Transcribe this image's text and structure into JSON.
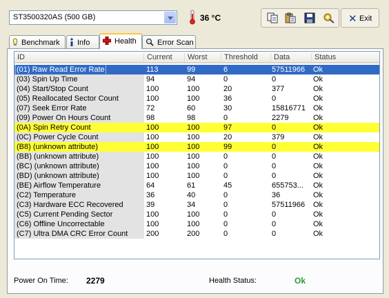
{
  "drive": {
    "selected": "ST3500320AS (500 GB)"
  },
  "temperature": {
    "value": "36 °C"
  },
  "toolbar": {
    "icons": [
      "copy-icon",
      "paste-icon",
      "save-icon",
      "options-icon"
    ]
  },
  "exit_label": "Exit",
  "tabs": [
    {
      "label": "Benchmark",
      "icon": "benchmark-icon"
    },
    {
      "label": "Info",
      "icon": "info-icon"
    },
    {
      "label": "Health",
      "icon": "health-cross-icon",
      "active": true
    },
    {
      "label": "Error Scan",
      "icon": "magnifier-icon"
    }
  ],
  "table": {
    "columns": [
      "ID",
      "Current",
      "Worst",
      "Threshold",
      "Data",
      "Status"
    ],
    "rows": [
      {
        "id": "(01) Raw Read Error Rate",
        "current": "113",
        "worst": "99",
        "threshold": "6",
        "data": "57511966",
        "status": "Ok",
        "state": "selected"
      },
      {
        "id": "(03) Spin Up Time",
        "current": "94",
        "worst": "94",
        "threshold": "0",
        "data": "0",
        "status": "Ok"
      },
      {
        "id": "(04) Start/Stop Count",
        "current": "100",
        "worst": "100",
        "threshold": "20",
        "data": "377",
        "status": "Ok"
      },
      {
        "id": "(05) Reallocated Sector Count",
        "current": "100",
        "worst": "100",
        "threshold": "36",
        "data": "0",
        "status": "Ok"
      },
      {
        "id": "(07) Seek Error Rate",
        "current": "72",
        "worst": "60",
        "threshold": "30",
        "data": "15816771",
        "status": "Ok"
      },
      {
        "id": "(09) Power On Hours Count",
        "current": "98",
        "worst": "98",
        "threshold": "0",
        "data": "2279",
        "status": "Ok"
      },
      {
        "id": "(0A) Spin Retry Count",
        "current": "100",
        "worst": "100",
        "threshold": "97",
        "data": "0",
        "status": "Ok",
        "state": "highlight"
      },
      {
        "id": "(0C) Power Cycle Count",
        "current": "100",
        "worst": "100",
        "threshold": "20",
        "data": "379",
        "status": "Ok"
      },
      {
        "id": "(B8) (unknown attribute)",
        "current": "100",
        "worst": "100",
        "threshold": "99",
        "data": "0",
        "status": "Ok",
        "state": "highlight"
      },
      {
        "id": "(BB) (unknown attribute)",
        "current": "100",
        "worst": "100",
        "threshold": "0",
        "data": "0",
        "status": "Ok"
      },
      {
        "id": "(BC) (unknown attribute)",
        "current": "100",
        "worst": "100",
        "threshold": "0",
        "data": "0",
        "status": "Ok"
      },
      {
        "id": "(BD) (unknown attribute)",
        "current": "100",
        "worst": "100",
        "threshold": "0",
        "data": "0",
        "status": "Ok"
      },
      {
        "id": "(BE) Airflow Temperature",
        "current": "64",
        "worst": "61",
        "threshold": "45",
        "data": "655753...",
        "status": "Ok"
      },
      {
        "id": "(C2) Temperature",
        "current": "36",
        "worst": "40",
        "threshold": "0",
        "data": "36",
        "status": "Ok"
      },
      {
        "id": "(C3) Hardware ECC Recovered",
        "current": "39",
        "worst": "34",
        "threshold": "0",
        "data": "57511966",
        "status": "Ok"
      },
      {
        "id": "(C5) Current Pending Sector",
        "current": "100",
        "worst": "100",
        "threshold": "0",
        "data": "0",
        "status": "Ok"
      },
      {
        "id": "(C6) Offline Uncorrectable",
        "current": "100",
        "worst": "100",
        "threshold": "0",
        "data": "0",
        "status": "Ok"
      },
      {
        "id": "(C7) Ultra DMA CRC Error Count",
        "current": "200",
        "worst": "200",
        "threshold": "0",
        "data": "0",
        "status": "Ok"
      }
    ]
  },
  "footer": {
    "power_on_label": "Power On Time:",
    "power_on_value": "2279",
    "health_label": "Health Status:",
    "health_value": "Ok"
  },
  "colors": {
    "selected_row": "#316ac5",
    "highlight_row": "#ffff33",
    "health_ok": "#2e9d2e"
  }
}
